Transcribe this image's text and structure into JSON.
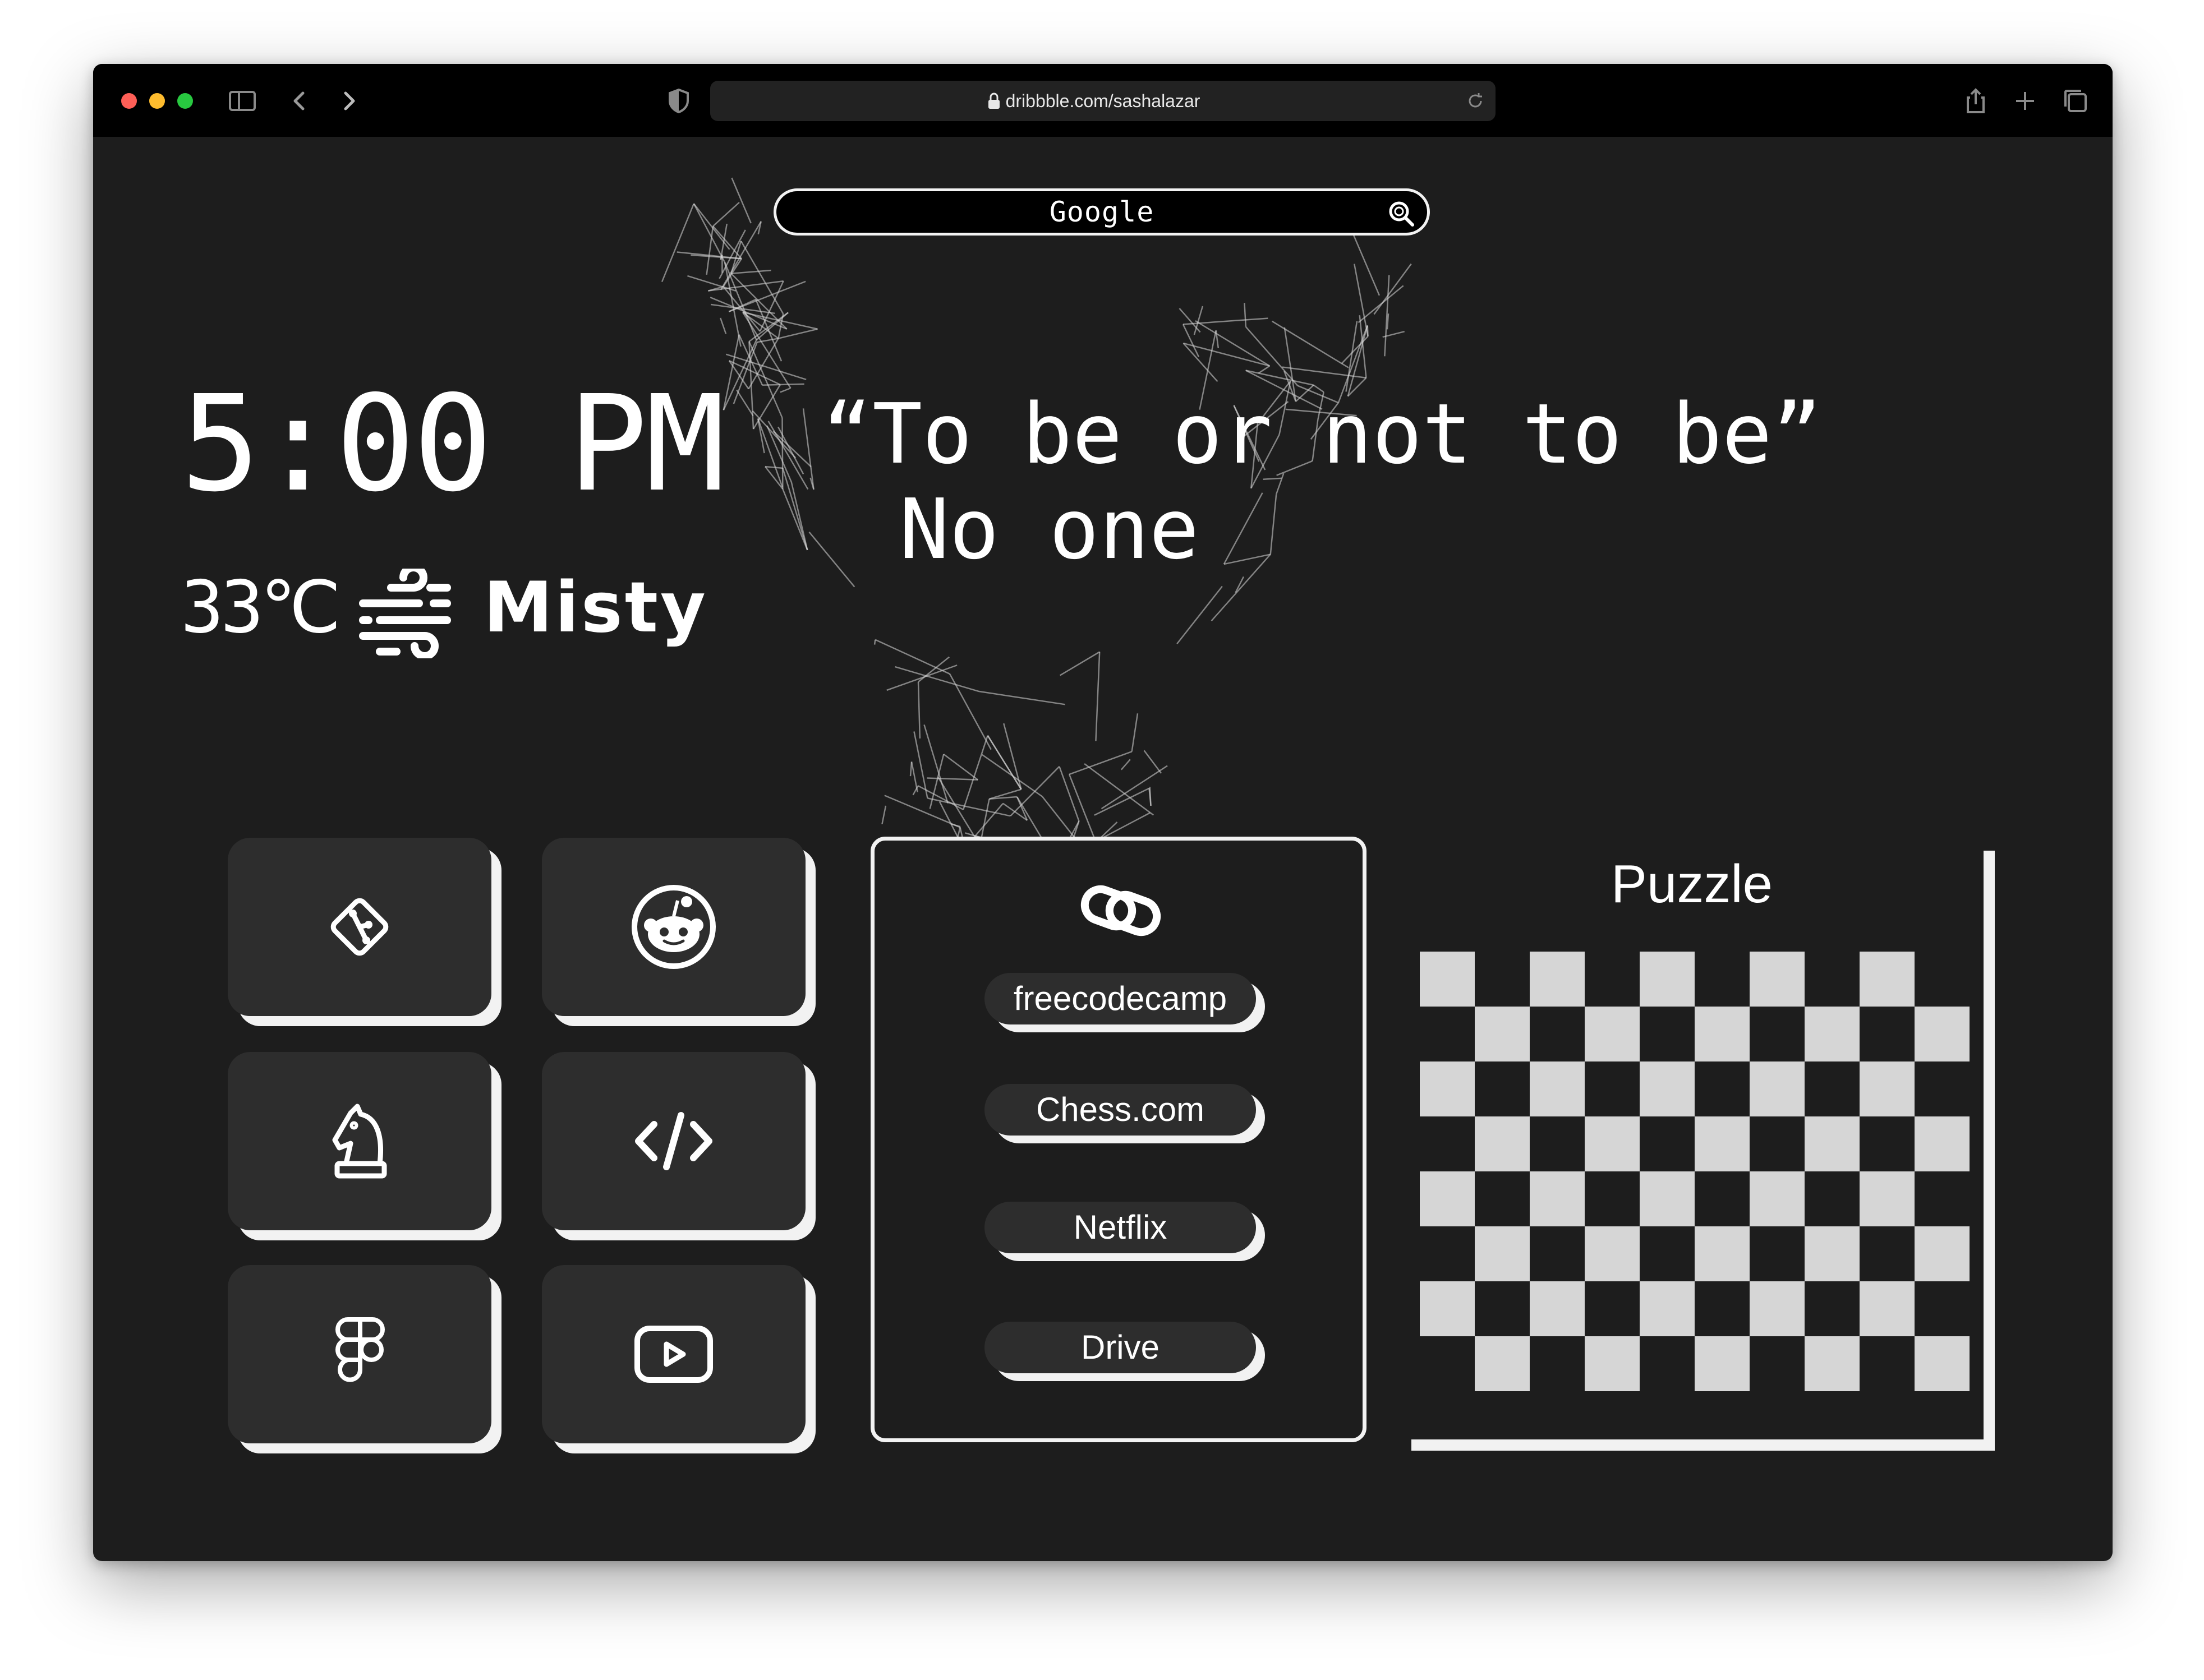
{
  "browser": {
    "url": "dribbble.com/sashalazar",
    "icons": [
      "sidebar-icon",
      "back-icon",
      "forward-icon",
      "shield-icon",
      "lock-icon",
      "reload-icon",
      "share-icon",
      "new-tab-icon",
      "tabs-overview-icon"
    ]
  },
  "search": {
    "label": "Google",
    "icon": "search-icon"
  },
  "clock": {
    "time": "5:00 PM"
  },
  "weather": {
    "temperature": "33℃",
    "condition": "Misty",
    "icon": "wind-icon"
  },
  "quote": {
    "text": "“To be or not to be”",
    "author": "No one"
  },
  "shortcuts": [
    {
      "name": "git",
      "icon": "git-icon"
    },
    {
      "name": "reddit",
      "icon": "reddit-icon"
    },
    {
      "name": "chess",
      "icon": "chess-knight-icon"
    },
    {
      "name": "code",
      "icon": "code-icon"
    },
    {
      "name": "figma",
      "icon": "figma-icon"
    },
    {
      "name": "youtube",
      "icon": "youtube-icon"
    }
  ],
  "links": {
    "icon": "link-icon",
    "items": [
      "freecodecamp",
      "Chess.com",
      "Netflix",
      "Drive"
    ]
  },
  "puzzle": {
    "title": "Puzzle",
    "rows": 8,
    "cols": 10
  },
  "colors": {
    "background": "#1d1d1d",
    "tile": "#2d2d2d",
    "accent": "#f2f2f2",
    "board": "#d6d6d6"
  }
}
